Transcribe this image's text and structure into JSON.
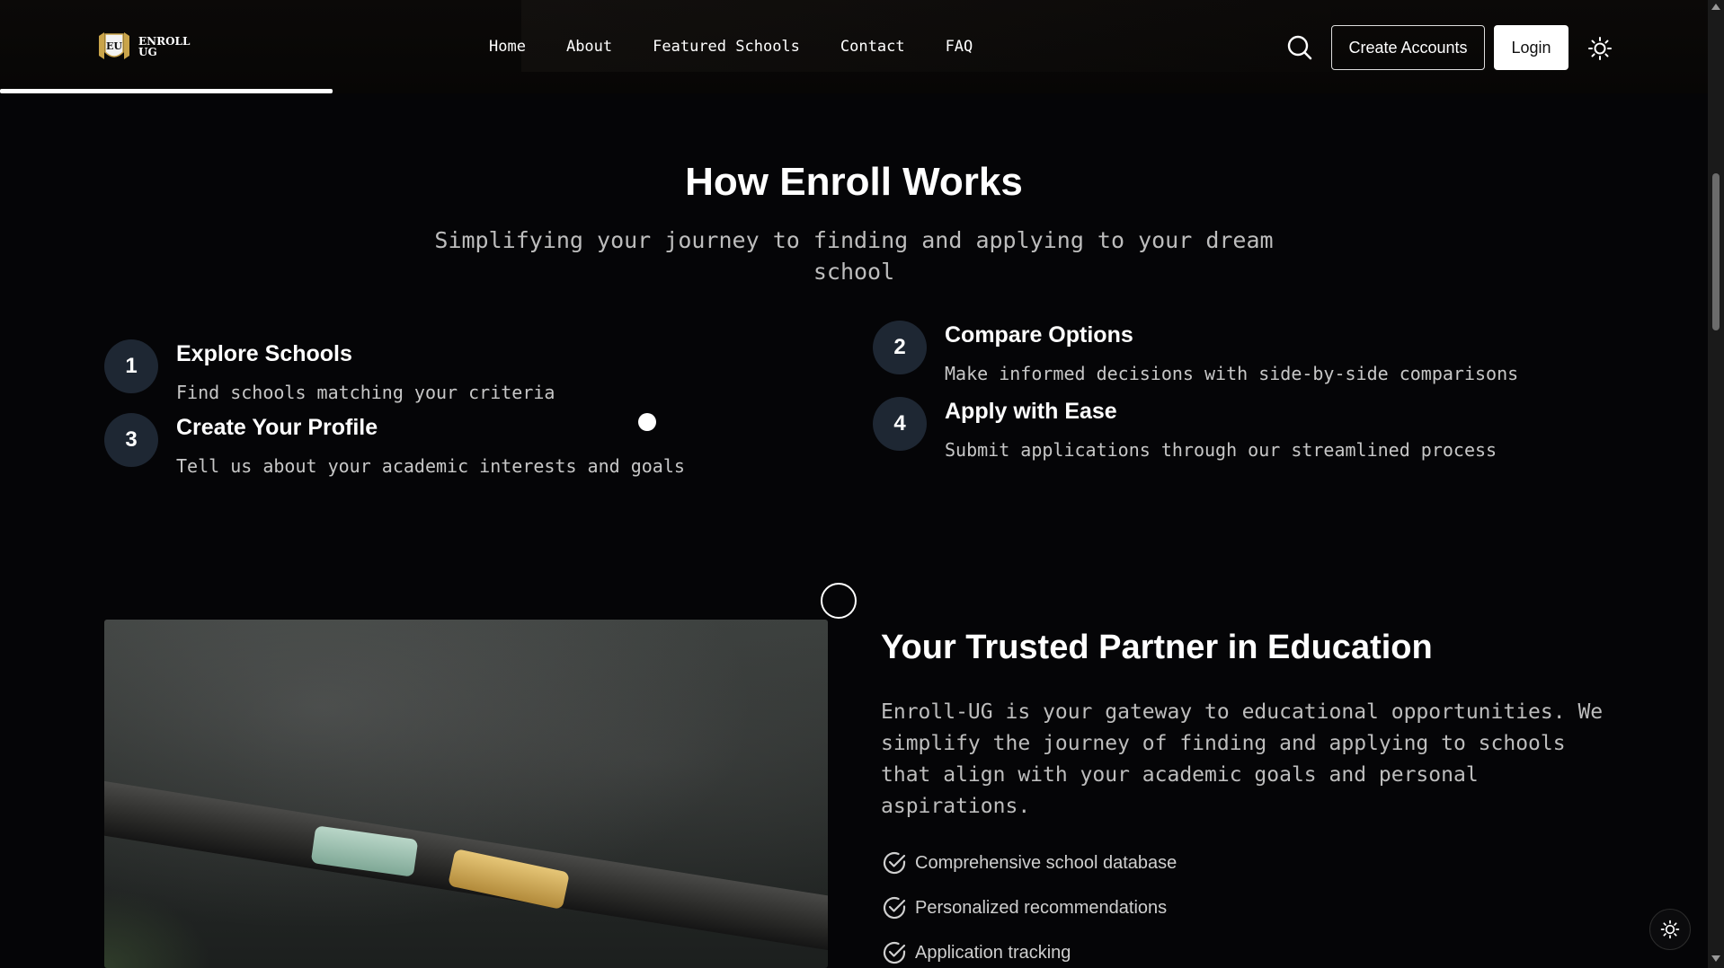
{
  "header": {
    "logo_line1": "ENROLL",
    "logo_line2": "UG",
    "logo_badge": "EU",
    "nav": [
      "Home",
      "About",
      "Featured Schools",
      "Contact",
      "FAQ"
    ],
    "create_accounts": "Create Accounts",
    "login": "Login",
    "search_icon": "search-icon",
    "theme_icon": "sun-icon"
  },
  "how": {
    "title": "How Enroll Works",
    "subtitle": "Simplifying your journey to finding and applying to your dream school",
    "steps": [
      {
        "num": "1",
        "title": "Explore Schools",
        "desc": "Find schools matching your criteria"
      },
      {
        "num": "2",
        "title": "Compare Options",
        "desc": "Make informed decisions with side-by-side comparisons"
      },
      {
        "num": "3",
        "title": "Create Your Profile",
        "desc": "Tell us about your academic interests and goals"
      },
      {
        "num": "4",
        "title": "Apply with Ease",
        "desc": "Submit applications through our streamlined process"
      }
    ]
  },
  "partner": {
    "title": "Your Trusted Partner in Education",
    "text": "Enroll-UG is your gateway to educational opportunities. We simplify the journey of finding and applying to schools that align with your academic goals and personal aspirations.",
    "features": [
      "Comprehensive school database",
      "Personalized recommendations",
      "Application tracking"
    ]
  },
  "colors": {
    "background": "#050507",
    "step_circle": "#1e2733",
    "accent": "#ffffff"
  }
}
